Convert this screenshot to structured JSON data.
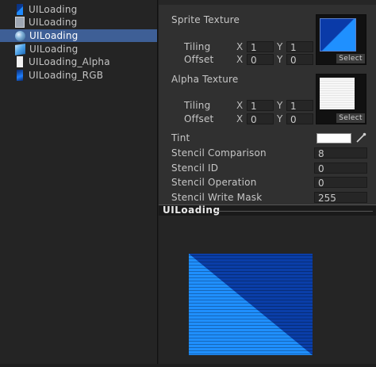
{
  "project": {
    "items": [
      {
        "label": "UILoading",
        "icon": "sprite-icon",
        "selected": false
      },
      {
        "label": "UILoading",
        "icon": "material-file-icon",
        "selected": false
      },
      {
        "label": "UILoading",
        "icon": "material-sphere-icon",
        "selected": true
      },
      {
        "label": "UILoading",
        "icon": "prefab-cube-icon",
        "selected": false
      },
      {
        "label": "UILoading_Alpha",
        "icon": "alpha-texture-icon",
        "selected": false
      },
      {
        "label": "UILoading_RGB",
        "icon": "rgb-texture-icon",
        "selected": false
      }
    ]
  },
  "inspector": {
    "sprite_texture": {
      "label": "Sprite Texture",
      "tiling_label": "Tiling",
      "offset_label": "Offset",
      "tiling": {
        "x": "1",
        "y": "1"
      },
      "offset": {
        "x": "0",
        "y": "0"
      },
      "select_label": "Select"
    },
    "alpha_texture": {
      "label": "Alpha Texture",
      "tiling_label": "Tiling",
      "offset_label": "Offset",
      "tiling": {
        "x": "1",
        "y": "1"
      },
      "offset": {
        "x": "0",
        "y": "0"
      },
      "select_label": "Select"
    },
    "axis_x": "X",
    "axis_y": "Y",
    "tint": {
      "label": "Tint",
      "color": "#ffffff"
    },
    "properties": [
      {
        "label": "Stencil Comparison",
        "value": "8"
      },
      {
        "label": "Stencil ID",
        "value": "0"
      },
      {
        "label": "Stencil Operation",
        "value": "0"
      },
      {
        "label": "Stencil Write Mask",
        "value": "255"
      }
    ]
  },
  "preview": {
    "title": "UILoading",
    "colors": {
      "light_blue": "#1f8fff",
      "dark_blue": "#0a3ea8"
    }
  },
  "colors": {
    "selection": "#3e5f96",
    "panel": "#303030",
    "background": "#1e1e1e"
  }
}
